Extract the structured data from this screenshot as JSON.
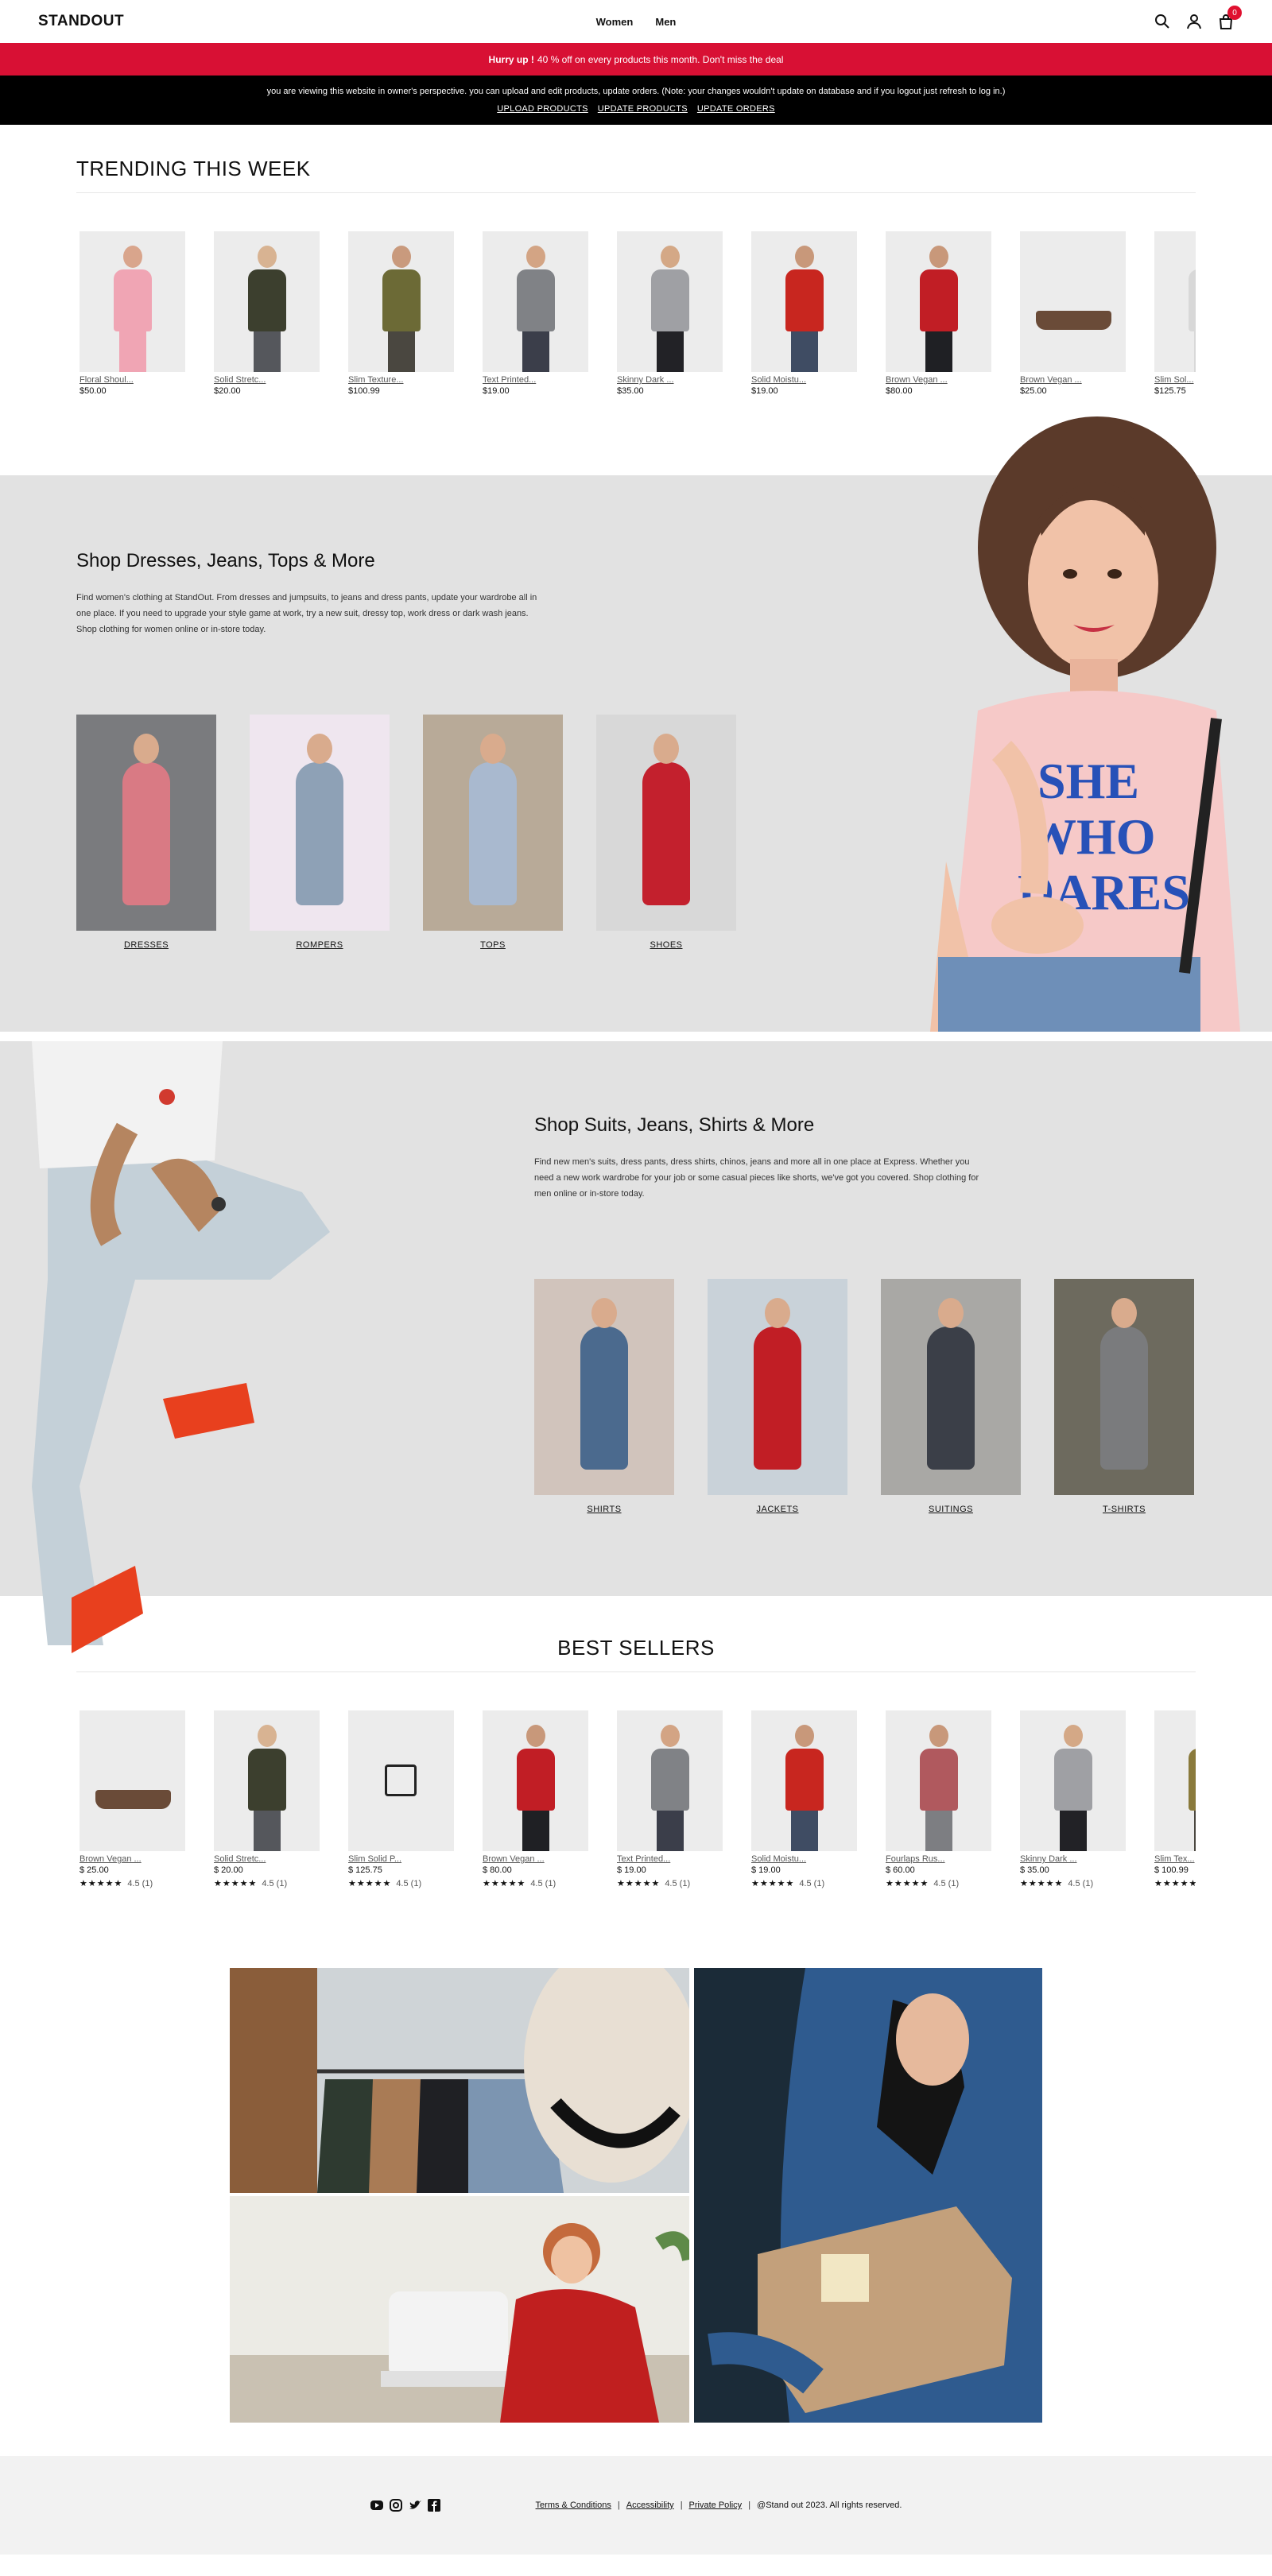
{
  "header": {
    "logo": "STANDOUT",
    "nav": [
      "Women",
      "Men"
    ],
    "cart_count": "0"
  },
  "promo": {
    "bold": "Hurry up !",
    "text": " 40 % off on every products this month. Don't miss the deal"
  },
  "owner_bar": {
    "notice": "you are viewing this website in owner's perspective. you can upload and edit products, update orders. (Note: your changes wouldn't update on database and if you logout just refresh to log in.)",
    "links": [
      "UPLOAD PRODUCTS",
      "UPDATE PRODUCTS",
      "UPDATE ORDERS"
    ]
  },
  "trending": {
    "title": "TRENDING THIS WEEK",
    "products": [
      {
        "name": "Floral Shoul...",
        "price": "$50.00",
        "icon": "woman-pink-dress",
        "colors": {
          "skin": "#d9a58c",
          "top": "#f0a5b4",
          "bottom": "#f0a5b4"
        }
      },
      {
        "name": "Solid Stretc...",
        "price": "$20.00",
        "icon": "man-dark-shirt",
        "colors": {
          "skin": "#d8b392",
          "top": "#3c3f2e",
          "bottom": "#55575c"
        }
      },
      {
        "name": "Slim Texture...",
        "price": "$100.99",
        "icon": "man-olive-blazer",
        "colors": {
          "skin": "#c99a7d",
          "top": "#6c6a36",
          "bottom": "#4a4740"
        }
      },
      {
        "name": "Text Printed...",
        "price": "$19.00",
        "icon": "man-gray-tee",
        "colors": {
          "skin": "#d3a484",
          "top": "#808286",
          "bottom": "#3b3e4a"
        }
      },
      {
        "name": "Skinny Dark ...",
        "price": "$35.00",
        "icon": "man-gray-tee-black-jeans",
        "colors": {
          "skin": "#d4a886",
          "top": "#9fa0a4",
          "bottom": "#222226"
        }
      },
      {
        "name": "Solid Moistu...",
        "price": "$19.00",
        "icon": "man-red-polo",
        "colors": {
          "skin": "#c8987a",
          "top": "#c8261f",
          "bottom": "#3f4c63"
        }
      },
      {
        "name": "Brown Vegan ...",
        "price": "$80.00",
        "icon": "man-red-jacket",
        "colors": {
          "skin": "#c8987a",
          "top": "#c11e25",
          "bottom": "#1f2024"
        }
      },
      {
        "name": "Brown Vegan ...",
        "price": "$25.00",
        "icon": "brown-wallet",
        "colors": {
          "skin": "#6a4b38",
          "top": "#6a4b38",
          "bottom": "#6a4b38"
        }
      },
      {
        "name": "Slim Sol...",
        "price": "$125.75",
        "icon": "man-partial",
        "colors": {
          "skin": "#d4d4d4",
          "top": "#d8d8d8",
          "bottom": "#d8d8d8"
        }
      }
    ]
  },
  "women": {
    "title": "Shop Dresses, Jeans, Tops & More",
    "text": "Find women's clothing at StandOut. From dresses and jumpsuits, to jeans and dress pants, update your wardrobe all in one place. If you need to upgrade your style game at work, try a new suit, dressy top, work dress or dark wash jeans. Shop clothing for women online or in-store today.",
    "categories": [
      {
        "label": "DRESSES",
        "bg": "#7a7b7e",
        "accent": "#d97a84"
      },
      {
        "label": "ROMPERS",
        "bg": "#efe6ef",
        "accent": "#8ea1b6"
      },
      {
        "label": "TOPS",
        "bg": "#b8aa98",
        "accent": "#a9b9cf"
      },
      {
        "label": "SHOES",
        "bg": "#d8d8d8",
        "accent": "#c3202d"
      }
    ],
    "hero_text": "SHE WHO DARES"
  },
  "men": {
    "title": "Shop Suits, Jeans, Shirts & More",
    "text": "Find new men's suits, dress pants, dress shirts, chinos, jeans and more all in one place at Express. Whether you need a new work wardrobe for your job or some casual pieces like shorts, we've got you covered. Shop clothing for men online or in-store today.",
    "categories": [
      {
        "label": "SHIRTS",
        "bg": "#d1c4bc",
        "accent": "#4b6a8e"
      },
      {
        "label": "JACKETS",
        "bg": "#c9d2d9",
        "accent": "#c11e25"
      },
      {
        "label": "SUITINGS",
        "bg": "#a9a8a5",
        "accent": "#3b3f48"
      },
      {
        "label": "T-SHIRTS",
        "bg": "#6d6a5e",
        "accent": "#7a7b7d"
      }
    ]
  },
  "best": {
    "title": "BEST SELLERS",
    "rating_stars": "★★★★★",
    "products": [
      {
        "name": "Brown Vegan ...",
        "price": "$ 25.00",
        "rating": "4.5 (1)",
        "icon": "brown-wallet",
        "colors": {
          "skin": "#6a4b38",
          "top": "#6a4b38",
          "bottom": "#6a4b38"
        }
      },
      {
        "name": "Solid Stretc...",
        "price": "$ 20.00",
        "rating": "4.5 (1)",
        "icon": "man-dark-shirt",
        "colors": {
          "skin": "#d8b392",
          "top": "#3c3f2e",
          "bottom": "#55575c"
        }
      },
      {
        "name": "Slim Solid P...",
        "price": "$ 125.75",
        "rating": "4.5 (1)",
        "icon": "image-not-found",
        "colors": {
          "skin": "#222",
          "top": "#222",
          "bottom": "#222"
        }
      },
      {
        "name": "Brown Vegan ...",
        "price": "$ 80.00",
        "rating": "4.5 (1)",
        "icon": "man-red-jacket",
        "colors": {
          "skin": "#c8987a",
          "top": "#c11e25",
          "bottom": "#1f2024"
        }
      },
      {
        "name": "Text Printed...",
        "price": "$ 19.00",
        "rating": "4.5 (1)",
        "icon": "man-gray-tee",
        "colors": {
          "skin": "#d3a484",
          "top": "#808286",
          "bottom": "#3b3e4a"
        }
      },
      {
        "name": "Solid Moistu...",
        "price": "$ 19.00",
        "rating": "4.5 (1)",
        "icon": "man-red-polo",
        "colors": {
          "skin": "#c8987a",
          "top": "#c8261f",
          "bottom": "#3f4c63"
        }
      },
      {
        "name": "Fourlaps Rus...",
        "price": "$ 60.00",
        "rating": "4.5 (1)",
        "icon": "man-hoodie",
        "colors": {
          "skin": "#c8987a",
          "top": "#b0595e",
          "bottom": "#7d7e82"
        }
      },
      {
        "name": "Skinny Dark ...",
        "price": "$ 35.00",
        "rating": "4.5 (1)",
        "icon": "man-gray-tee-black-jeans",
        "colors": {
          "skin": "#d4a886",
          "top": "#9fa0a4",
          "bottom": "#222226"
        }
      },
      {
        "name": "Slim Tex...",
        "price": "$ 100.99",
        "rating": "",
        "icon": "man-partial",
        "colors": {
          "skin": "#c99a7d",
          "top": "#8a7a3c",
          "bottom": "#4a4740"
        }
      }
    ]
  },
  "footer": {
    "social": [
      "youtube-icon",
      "instagram-icon",
      "twitter-icon",
      "facebook-icon"
    ],
    "links": [
      "Terms & Conditions",
      "Accessibility",
      "Private Policy"
    ],
    "copyright": "@Stand out 2023. All rights reserved."
  },
  "colors": {
    "accent": "#d81034",
    "section_bg": "#e2e2e2"
  }
}
